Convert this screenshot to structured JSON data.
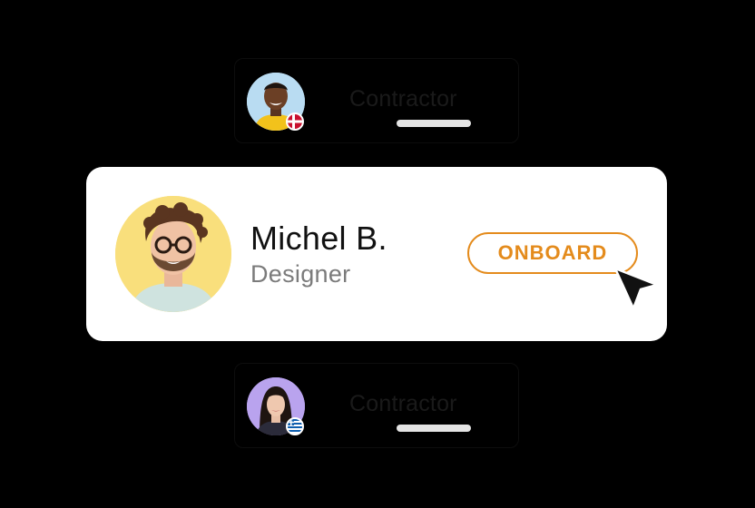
{
  "cards": {
    "top": {
      "label": "Contractor",
      "flag": "denmark-flag-icon"
    },
    "main": {
      "name": "Michel B.",
      "role": "Designer",
      "button_label": "ONBOARD"
    },
    "bottom": {
      "label": "Contractor",
      "flag": "greece-flag-icon"
    }
  },
  "colors": {
    "background": "#000000",
    "card": "#ffffff",
    "accent": "#e48b1c",
    "avatar_main_bg": "#f9df7c",
    "avatar_top_bg": "#b9dcf2",
    "avatar_bottom_bg": "#b9a3ee"
  }
}
